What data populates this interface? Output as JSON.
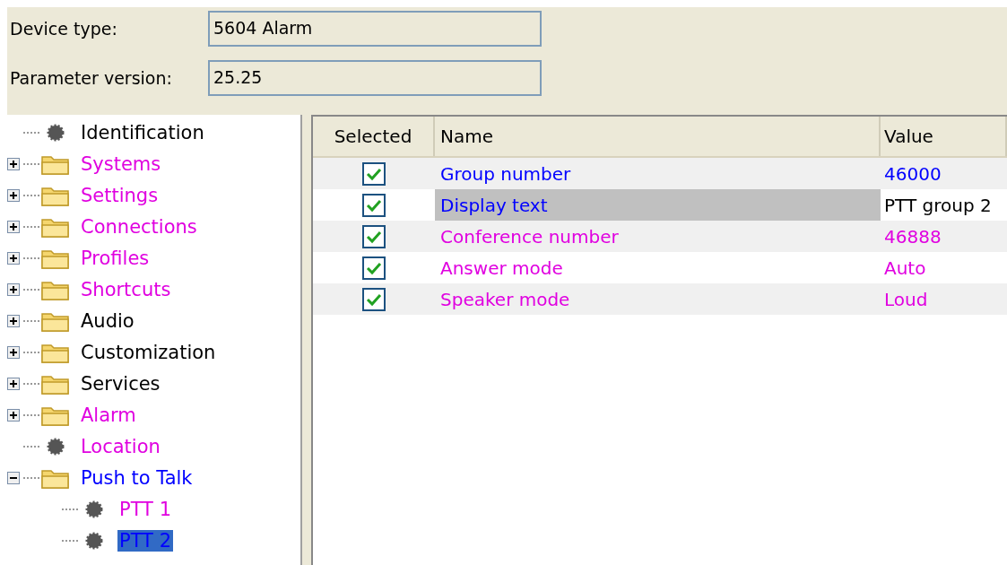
{
  "header": {
    "fields": [
      {
        "label": "Device type:",
        "value": "5604 Alarm"
      },
      {
        "label": "Parameter version:",
        "value": "25.25"
      }
    ]
  },
  "tree": [
    {
      "label": "Identification",
      "kind": "leaf",
      "color": "#000000",
      "selected": false
    },
    {
      "label": "Systems",
      "kind": "folder",
      "expanded": false,
      "color": "#e000e0",
      "selected": false
    },
    {
      "label": "Settings",
      "kind": "folder",
      "expanded": false,
      "color": "#e000e0",
      "selected": false
    },
    {
      "label": "Connections",
      "kind": "folder",
      "expanded": false,
      "color": "#e000e0",
      "selected": false
    },
    {
      "label": "Profiles",
      "kind": "folder",
      "expanded": false,
      "color": "#e000e0",
      "selected": false
    },
    {
      "label": "Shortcuts",
      "kind": "folder",
      "expanded": false,
      "color": "#e000e0",
      "selected": false
    },
    {
      "label": "Audio",
      "kind": "folder",
      "expanded": false,
      "color": "#000000",
      "selected": false
    },
    {
      "label": "Customization",
      "kind": "folder",
      "expanded": false,
      "color": "#000000",
      "selected": false
    },
    {
      "label": "Services",
      "kind": "folder",
      "expanded": false,
      "color": "#000000",
      "selected": false
    },
    {
      "label": "Alarm",
      "kind": "folder",
      "expanded": false,
      "color": "#e000e0",
      "selected": false
    },
    {
      "label": "Location",
      "kind": "leaf",
      "color": "#e000e0",
      "selected": false
    },
    {
      "label": "Push to Talk",
      "kind": "folder",
      "expanded": true,
      "color": "#0000ff",
      "selected": false,
      "children": [
        {
          "label": "PTT 1",
          "kind": "leaf",
          "color": "#e000e0",
          "selected": false
        },
        {
          "label": "PTT 2",
          "kind": "leaf",
          "selected": true
        }
      ]
    }
  ],
  "table": {
    "columns": [
      "Selected",
      "Name",
      "Value"
    ],
    "rows": [
      {
        "checked": true,
        "name": "Group number",
        "value": "46000",
        "color": "#0000ff",
        "selected": false
      },
      {
        "checked": true,
        "name": "Display text",
        "value": "PTT group 2",
        "color": "#0000ff",
        "selected": true
      },
      {
        "checked": true,
        "name": "Conference number",
        "value": "46888",
        "color": "#e000e0",
        "selected": false
      },
      {
        "checked": true,
        "name": "Answer mode",
        "value": "Auto",
        "color": "#e000e0",
        "selected": false
      },
      {
        "checked": true,
        "name": "Speaker mode",
        "value": "Loud",
        "color": "#e000e0",
        "selected": false
      }
    ]
  }
}
